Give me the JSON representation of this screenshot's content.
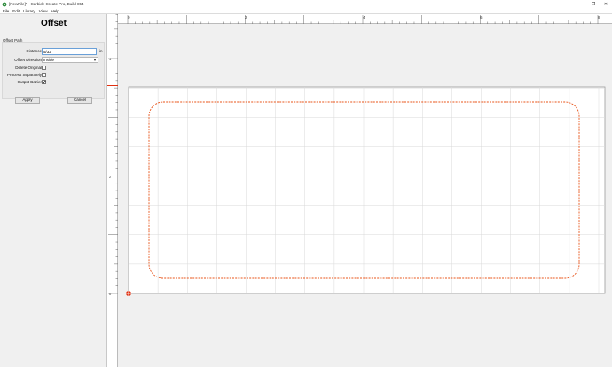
{
  "window": {
    "title": "[NewFile]* - Carbide Create Pro, Build 854",
    "controls": [
      "—",
      "❐",
      "✕"
    ]
  },
  "menu": [
    {
      "label": "File",
      "key": "F"
    },
    {
      "label": "Edit",
      "key": "E"
    },
    {
      "label": "Library",
      "key": ""
    },
    {
      "label": "View",
      "key": ""
    },
    {
      "label": "Help",
      "key": "H"
    }
  ],
  "panel": {
    "title": "Offset",
    "group_label": "Offset Path",
    "distance_label": "Distance",
    "distance_value": "5/32",
    "distance_unit": "in",
    "direction_label": "Offset Direction",
    "direction_value": "Inside",
    "delete_original_label": "Delete Original",
    "delete_original_checked": false,
    "process_separately_label": "Process Separately",
    "process_separately_checked": false,
    "output_bezier_label": "Output Bezier",
    "output_bezier_checked": true,
    "apply_label": "Apply",
    "cancel_label": "Cancel"
  },
  "rulers": {
    "h_labels": [
      "0",
      "2",
      "4",
      "6",
      "8"
    ],
    "v_labels": [
      "4",
      "2",
      "0"
    ]
  },
  "colors": {
    "offset_path": "#e8541a",
    "origin_marker": "#e03010",
    "grid_line": "#d9d9d9"
  }
}
